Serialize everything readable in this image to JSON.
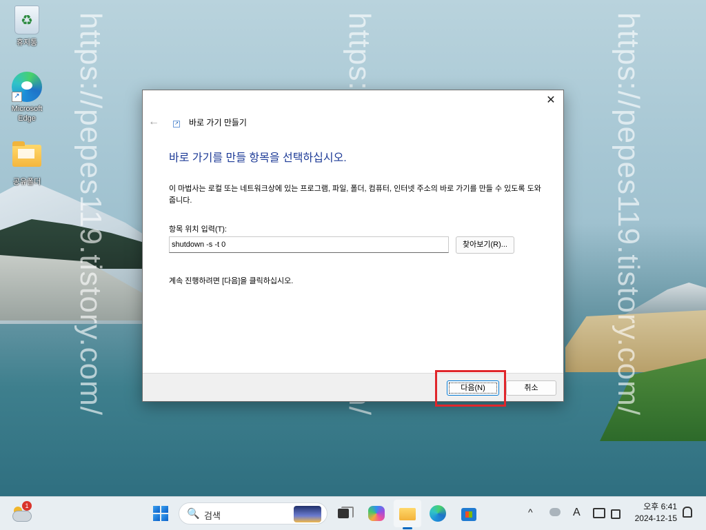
{
  "desktop": {
    "icons": [
      {
        "label": "휴지통",
        "icon": "recycle-bin-icon"
      },
      {
        "label": "Microsoft Edge",
        "icon": "edge-icon"
      },
      {
        "label": "공유폴더",
        "icon": "folder-icon"
      }
    ],
    "watermark": "https://pepes119.tistory.com/"
  },
  "dialog": {
    "close_glyph": "✕",
    "back_glyph": "←",
    "title": "바로 가기 만들기",
    "heading": "바로 가기를 만들 항목을 선택하십시오.",
    "description": "이 마법사는 로컬 또는 네트워크상에 있는 프로그램, 파일, 폴더, 컴퓨터, 인터넷 주소의 바로 가기를 만들 수 있도록 도와줍니다.",
    "location_label": "항목 위치 입력(T):",
    "location_value": "shutdown -s -t 0",
    "browse_label": "찾아보기(R)...",
    "continue_text": "계속 진행하려면 [다음]을 클릭하십시오.",
    "next_label": "다음(N)",
    "cancel_label": "취소"
  },
  "taskbar": {
    "weather_badge": "1",
    "search_placeholder": "검색",
    "search_glyph": "🔍",
    "tray": {
      "chevron": "^",
      "ime": "A"
    },
    "clock": {
      "time": "오후 6:41",
      "date": "2024-12-15"
    }
  },
  "colors": {
    "heading": "#1c3a96",
    "highlight": "#e0262b",
    "accent": "#0078d4"
  }
}
